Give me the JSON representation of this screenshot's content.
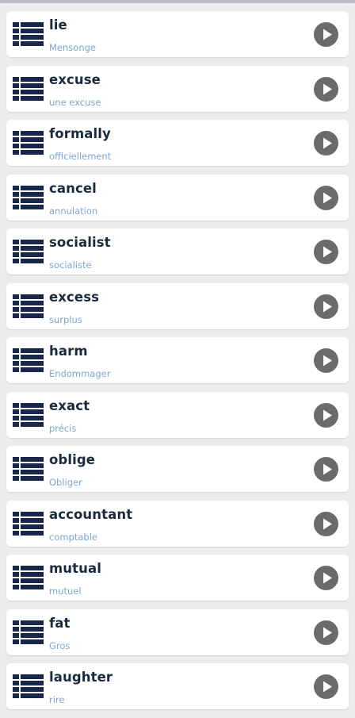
{
  "colors": {
    "background": "#ececec",
    "card": "#ffffff",
    "word_text": "#1c2a3f",
    "translation_text": "#7fa6d2",
    "list_icon": "#17264a",
    "play_button": "#6b6b6b"
  },
  "icons": {
    "list": "list-icon",
    "play": "play-icon"
  },
  "words": [
    {
      "word": "lie",
      "translation": "Mensonge"
    },
    {
      "word": "excuse",
      "translation": "une excuse"
    },
    {
      "word": "formally",
      "translation": "officiellement"
    },
    {
      "word": "cancel",
      "translation": "annulation"
    },
    {
      "word": "socialist",
      "translation": "socialiste"
    },
    {
      "word": "excess",
      "translation": "surplus"
    },
    {
      "word": "harm",
      "translation": "Endommager"
    },
    {
      "word": "exact",
      "translation": "précis"
    },
    {
      "word": "oblige",
      "translation": "Obliger"
    },
    {
      "word": "accountant",
      "translation": "comptable"
    },
    {
      "word": "mutual",
      "translation": "mutuel"
    },
    {
      "word": "fat",
      "translation": "Gros"
    },
    {
      "word": "laughter",
      "translation": "rire"
    }
  ]
}
